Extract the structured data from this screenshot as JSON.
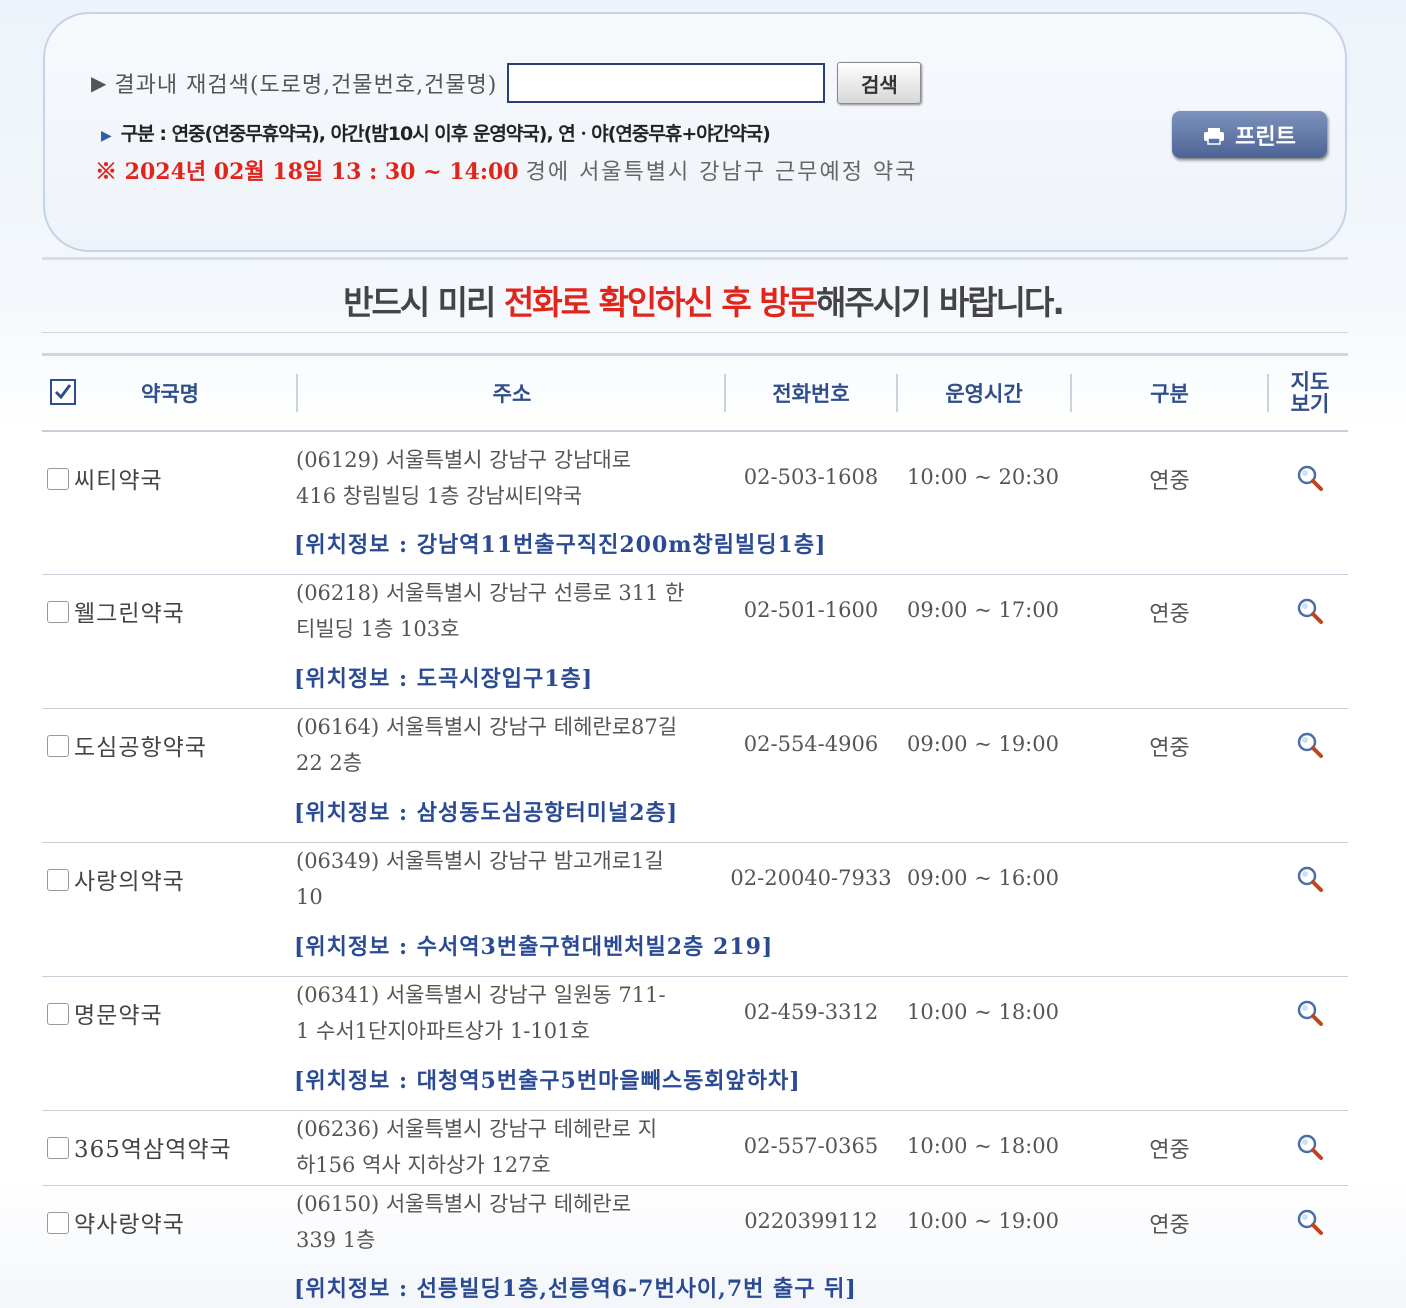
{
  "search": {
    "label": "결과내 재검색(도로명,건물번호,건물명)",
    "input_value": "",
    "input_placeholder": "",
    "button_label": "검색"
  },
  "legend": {
    "text": "구분 : 연중(연중무휴약국), 야간(밤10시 이후 운영약국), 연ㆍ야(연중무휴+야간약국)"
  },
  "datetime": {
    "highlight": "※ 2024년 02월 18일 13 : 30 ~ 14:00",
    "suffix": "경에 서울특별시 강남구 근무예정 약국"
  },
  "print_button": {
    "label": "프린트"
  },
  "notice": {
    "part1": "반드시 미리 ",
    "highlight": "전화로 확인하신 후 방문",
    "part2": "해주시기 바랍니다."
  },
  "table": {
    "headers": {
      "name": "약국명",
      "address": "주소",
      "phone": "전화번호",
      "hours": "운영시간",
      "kind": "구분",
      "map_line1": "지도",
      "map_line2": "보기"
    },
    "rows": [
      {
        "name": "씨티약국",
        "address_line1": "(06129) 서울특별시 강남구 강남대로",
        "address_line2": "416 창림빌딩 1층 강남씨티약국",
        "phone": "02-503-1608",
        "hours": "10:00 ~ 20:30",
        "kind": "연중",
        "location": "[위치정보 : 강남역11번출구직진200m창림빌딩1층]"
      },
      {
        "name": "웰그린약국",
        "address_line1": "(06218) 서울특별시 강남구 선릉로 311 한",
        "address_line2": "티빌딩 1층 103호",
        "phone": "02-501-1600",
        "hours": "09:00 ~ 17:00",
        "kind": "연중",
        "location": "[위치정보 : 도곡시장입구1층]"
      },
      {
        "name": "도심공항약국",
        "address_line1": "(06164) 서울특별시 강남구 테헤란로87길",
        "address_line2": "22 2층",
        "phone": "02-554-4906",
        "hours": "09:00 ~ 19:00",
        "kind": "연중",
        "location": "[위치정보 : 삼성동도심공항터미널2층]"
      },
      {
        "name": "사랑의약국",
        "address_line1": "(06349) 서울특별시 강남구 밤고개로1길",
        "address_line2": "10",
        "phone": "02-20040-7933",
        "hours": "09:00 ~ 16:00",
        "kind": "",
        "location": "[위치정보 : 수서역3번출구현대벤처빌2층 219]"
      },
      {
        "name": "명문약국",
        "address_line1": "(06341) 서울특별시 강남구 일원동 711-",
        "address_line2": "1 수서1단지아파트상가 1-101호",
        "phone": "02-459-3312",
        "hours": "10:00 ~ 18:00",
        "kind": "",
        "location": "[위치정보 : 대청역5번출구5번마을빼스동회앞하차]"
      },
      {
        "name": "365역삼역약국",
        "address_line1": "(06236) 서울특별시 강남구 테헤란로 지",
        "address_line2": "하156 역사 지하상가 127호",
        "phone": "02-557-0365",
        "hours": "10:00 ~ 18:00",
        "kind": "연중",
        "location": ""
      },
      {
        "name": "약사랑약국",
        "address_line1": "(06150) 서울특별시 강남구 테헤란로",
        "address_line2": "339 1층",
        "phone": "0220399112",
        "hours": "10:00 ~ 19:00",
        "kind": "연중",
        "location": "[위치정보 : 선릉빌딩1층,선릉역6-7번사이,7번 출구 뒤]"
      }
    ]
  },
  "colors": {
    "accent_red": "#e0251b",
    "link_blue": "#2a4a94",
    "header_blue": "#2f4e8a"
  }
}
